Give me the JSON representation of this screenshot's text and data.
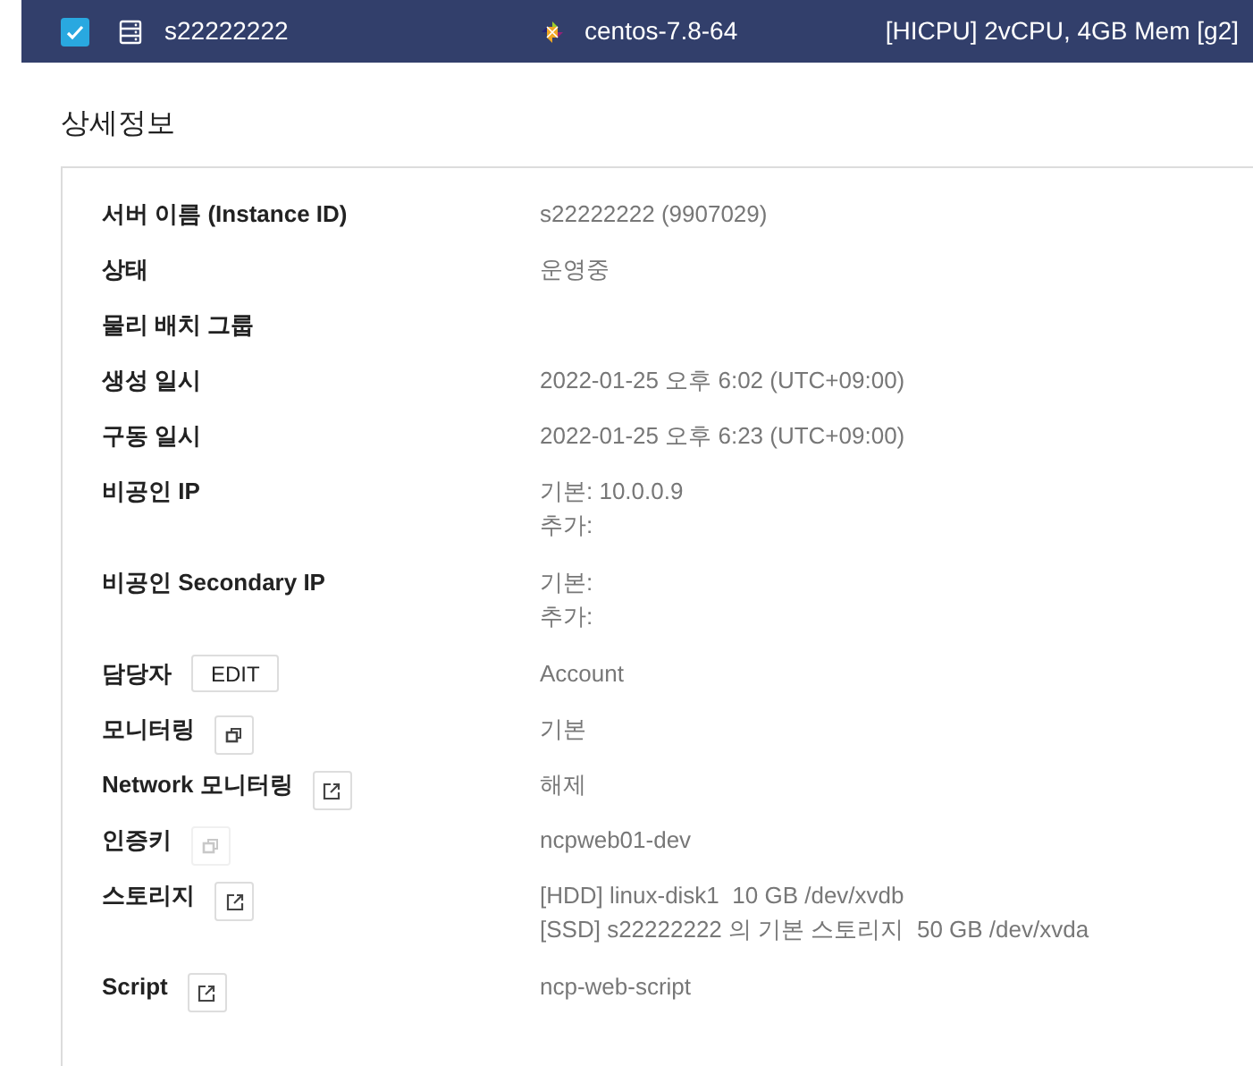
{
  "header": {
    "checked": true,
    "server_name": "s22222222",
    "os": "centos-7.8-64",
    "spec": "[HICPU] 2vCPU, 4GB Mem [g2]"
  },
  "section_title": "상세정보",
  "rows": [
    {
      "label": "서버 이름 (Instance ID)",
      "values": [
        "s22222222 (9907029)"
      ]
    },
    {
      "label": "상태",
      "values": [
        "운영중"
      ]
    },
    {
      "label": "물리 배치 그룹",
      "values": []
    },
    {
      "label": "생성 일시",
      "values": [
        "2022-01-25 오후 6:02 (UTC+09:00)"
      ]
    },
    {
      "label": "구동 일시",
      "values": [
        "2022-01-25 오후 6:23 (UTC+09:00)"
      ]
    },
    {
      "label": "비공인 IP",
      "values": [
        "기본: 10.0.0.9",
        "추가:"
      ]
    },
    {
      "label": "비공인 Secondary IP",
      "values": [
        "기본:",
        "추가:"
      ]
    },
    {
      "label": "담당자",
      "button": {
        "kind": "text",
        "label": "EDIT",
        "disabled": false
      },
      "values": [
        "Account"
      ]
    },
    {
      "label": "모니터링",
      "button": {
        "kind": "window",
        "disabled": false
      },
      "values": [
        "기본"
      ]
    },
    {
      "label": "Network 모니터링",
      "button": {
        "kind": "external",
        "disabled": false
      },
      "values": [
        "해제"
      ]
    },
    {
      "label": "인증키",
      "button": {
        "kind": "window",
        "disabled": true
      },
      "values": [
        "ncpweb01-dev"
      ]
    },
    {
      "label": "스토리지",
      "button": {
        "kind": "external",
        "disabled": false
      },
      "values": [
        "[HDD] linux-disk1  10 GB /dev/xvdb",
        "[SSD] s22222222 의 기본 스토리지  50 GB /dev/xvda"
      ]
    },
    {
      "label": "Script",
      "button": {
        "kind": "external",
        "disabled": false
      },
      "values": [
        "ncp-web-script"
      ]
    }
  ]
}
